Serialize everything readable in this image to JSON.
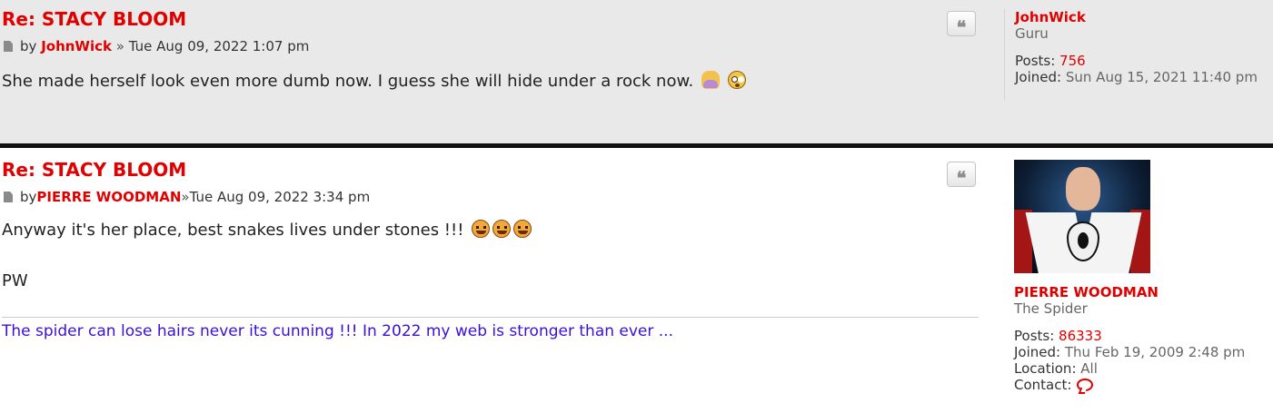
{
  "posts": [
    {
      "title": "Re: STACY BLOOM",
      "by_label": "by",
      "author": "JohnWick",
      "separator": "»",
      "date": "Tue Aug 09, 2022 1:07 pm",
      "content": "She made herself look even more dumb now. I guess she will hide under a rock now.",
      "quote_icon": "quote-icon",
      "profile": {
        "username": "JohnWick",
        "rank": "Guru",
        "posts_label": "Posts:",
        "posts_value": "756",
        "joined_label": "Joined:",
        "joined_value": "Sun Aug 15, 2021 11:40 pm"
      }
    },
    {
      "title": "Re: STACY BLOOM",
      "by_label": "by",
      "author": "PIERRE WOODMAN",
      "separator": "»",
      "date": "Tue Aug 09, 2022 3:34 pm",
      "content": "Anyway it's her place, best snakes lives under stones !!!",
      "content_signoff": "PW",
      "signature": "The spider can lose hairs never its cunning !!! In 2022 my web is stronger than ever ...",
      "quote_icon": "quote-icon",
      "profile": {
        "username": "PIERRE WOODMAN",
        "rank": "The Spider",
        "posts_label": "Posts:",
        "posts_value": "86333",
        "joined_label": "Joined:",
        "joined_value": "Thu Feb 19, 2009 2:48 pm",
        "location_label": "Location:",
        "location_value": "All",
        "contact_label": "Contact:",
        "contact_icon": "chat-bubble-icon"
      }
    }
  ],
  "colors": {
    "accent_red": "#e00000",
    "signature_blue": "#3d0fd6",
    "post_bg_alt": "#e9e9e9"
  }
}
